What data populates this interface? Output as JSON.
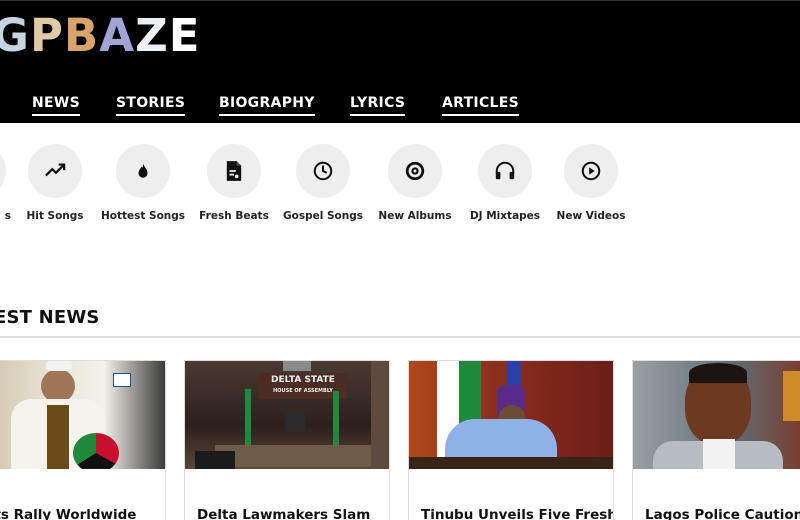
{
  "site": {
    "logo_letters": [
      "G",
      "P",
      "B",
      "A",
      "Z",
      "E"
    ],
    "logo_colors": [
      "#c6d4e4",
      "#e2c9a6",
      "#d9a36a",
      "#9fa4d6",
      "#eef0f8",
      "#ffffff"
    ]
  },
  "nav": {
    "items": [
      {
        "label": "NEWS"
      },
      {
        "label": "STORIES"
      },
      {
        "label": "BIOGRAPHY"
      },
      {
        "label": "LYRICS"
      },
      {
        "label": "ARTICLES"
      }
    ]
  },
  "categories": [
    {
      "label": "s",
      "icon": "partial-icon"
    },
    {
      "label": "Hit Songs",
      "icon": "trending-up-icon"
    },
    {
      "label": "Hottest Songs",
      "icon": "flame-icon"
    },
    {
      "label": "Fresh Beats",
      "icon": "music-file-icon"
    },
    {
      "label": "Gospel Songs",
      "icon": "clock-icon"
    },
    {
      "label": "New Albums",
      "icon": "disc-icon"
    },
    {
      "label": "DJ Mixtapes",
      "icon": "headphones-icon"
    },
    {
      "label": "New Videos",
      "icon": "play-circle-icon"
    }
  ],
  "latest": {
    "heading": "EST NEWS",
    "articles": [
      {
        "title": "vists Rally Worldwide"
      },
      {
        "title": "Delta Lawmakers Slam"
      },
      {
        "title": "Tinubu Unveils Five Fresh"
      },
      {
        "title": "Lagos Police Caution"
      }
    ]
  },
  "colors": {
    "header_bg": "#000000",
    "icon_circle": "#eeeeee"
  }
}
